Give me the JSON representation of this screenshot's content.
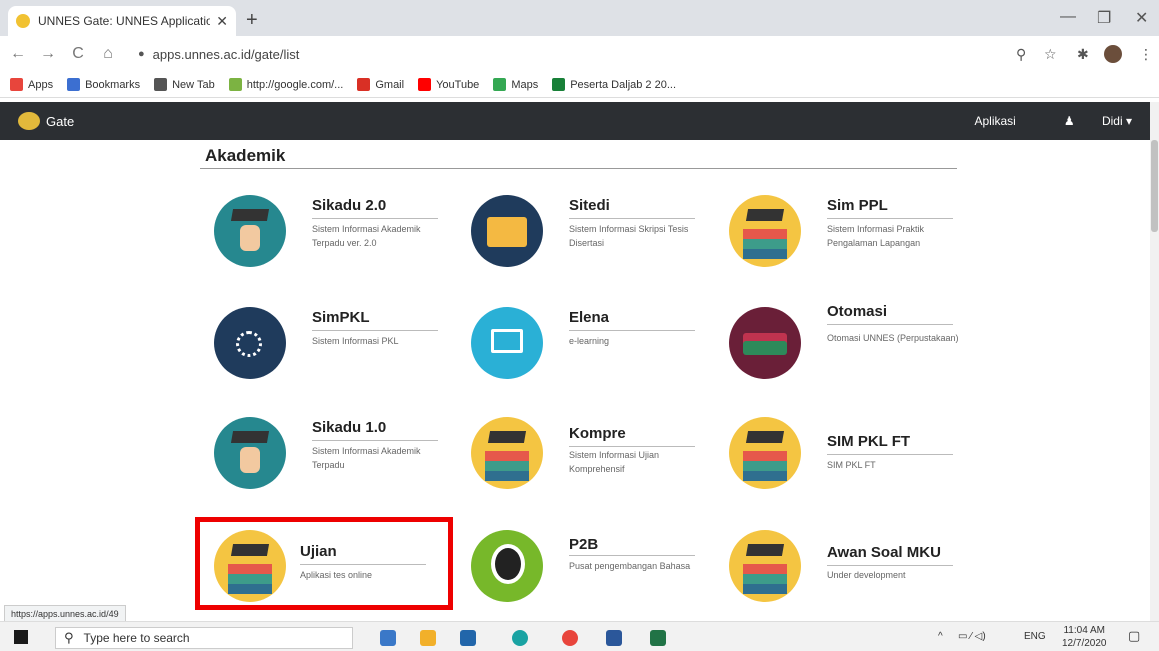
{
  "browser": {
    "tab_title": "UNNES Gate: UNNES Applicatio",
    "tab_close": "✕",
    "new_tab": "+",
    "url": "apps.unnes.ac.id/gate/list",
    "win_min": "—",
    "win_max": "❐",
    "win_close": "✕",
    "nav_back": "←",
    "nav_forward": "→",
    "nav_reload": "C",
    "nav_home": "⌂",
    "icon_zoom": "⚲",
    "icon_star": "☆",
    "icon_ext": "✱",
    "icon_menu": "⋮"
  },
  "bookmarks": [
    {
      "label": "Apps",
      "color": "#e8453c"
    },
    {
      "label": "Bookmarks",
      "color": "#3c6fd1"
    },
    {
      "label": "New Tab",
      "color": "#555555"
    },
    {
      "label": "http://google.com/...",
      "color": "#7cb342"
    },
    {
      "label": "Gmail",
      "color": "#d93025"
    },
    {
      "label": "YouTube",
      "color": "#ff0000"
    },
    {
      "label": "Maps",
      "color": "#34a853"
    },
    {
      "label": "Peserta Daljab 2 20...",
      "color": "#188038"
    }
  ],
  "navbar": {
    "brand": "Gate",
    "aplikasi": "Aplikasi",
    "user": "Didi ▾",
    "user_icon": "♟"
  },
  "section": {
    "title": "Akademik"
  },
  "apps": [
    {
      "name": "Sikadu 2.0",
      "desc": "Sistem Informasi Akademik Terpadu ver. 2.0"
    },
    {
      "name": "Sitedi",
      "desc": "Sistem Informasi Skripsi Tesis Disertasi"
    },
    {
      "name": "Sim PPL",
      "desc": "Sistem Informasi Praktik Pengalaman Lapangan"
    },
    {
      "name": "SimPKL",
      "desc": "Sistem Informasi PKL"
    },
    {
      "name": "Elena",
      "desc": "e-learning"
    },
    {
      "name": "Otomasi",
      "desc": "Otomasi UNNES (Perpustakaan)"
    },
    {
      "name": "Sikadu 1.0",
      "desc": "Sistem Informasi Akademik Terpadu"
    },
    {
      "name": "Kompre",
      "desc": "Sistem Informasi Ujian Komprehensif"
    },
    {
      "name": "SIM PKL FT",
      "desc": "SIM PKL FT"
    },
    {
      "name": "Ujian",
      "desc": "Aplikasi tes online"
    },
    {
      "name": "P2B",
      "desc": "Pusat pengembangan Bahasa"
    },
    {
      "name": "Awan Soal MKU",
      "desc": "Under development"
    }
  ],
  "status_url": "https://apps.unnes.ac.id/49",
  "taskbar": {
    "search_placeholder": "Type here to search",
    "search_icon": "⚲",
    "lang": "ENG",
    "time": "11:04 AM",
    "date": "12/7/2020",
    "tray_up": "^",
    "tray_icons": "▭ ⁄ ◁)",
    "notify": "▢"
  }
}
